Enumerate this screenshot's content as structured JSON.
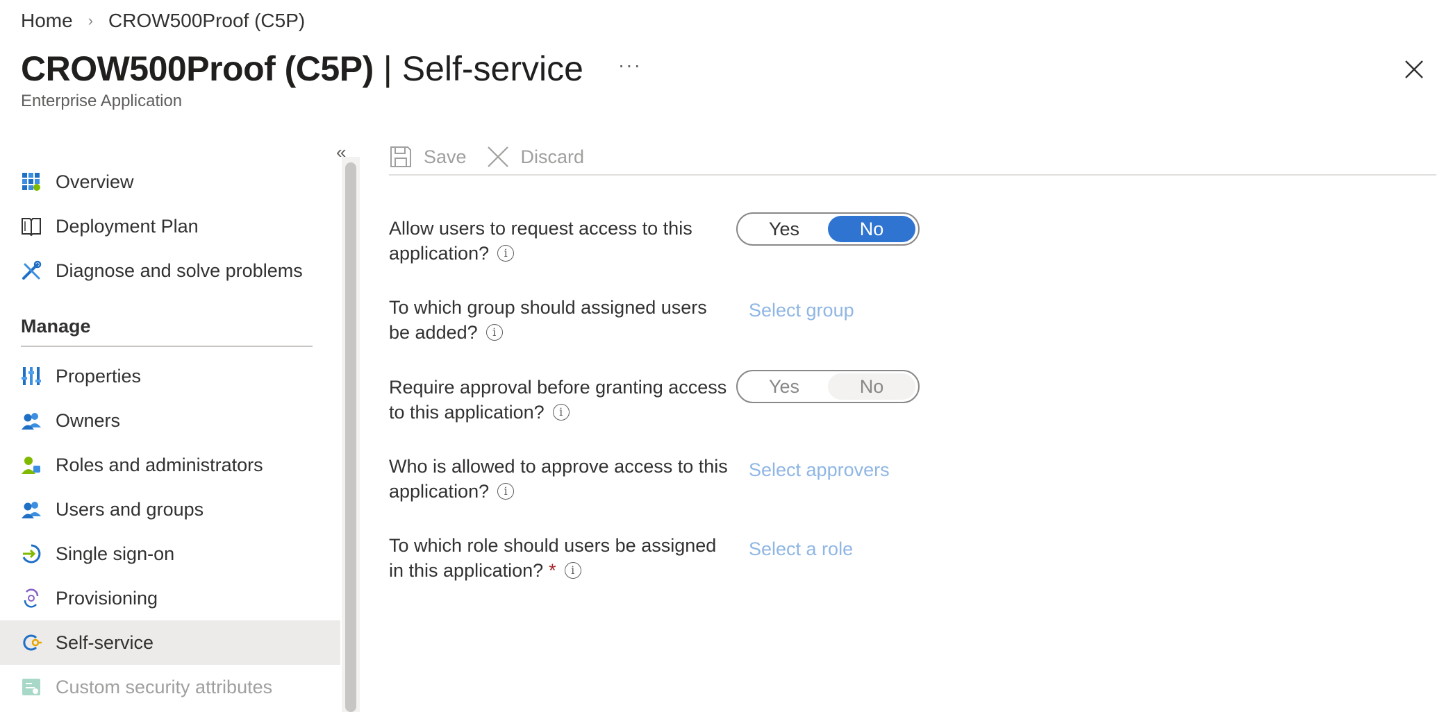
{
  "breadcrumb": {
    "home": "Home",
    "sep": "›",
    "current": "CROW500Proof (C5P)"
  },
  "header": {
    "title_main": "CROW500Proof (C5P)",
    "title_sep": "|",
    "title_sub": "Self-service",
    "more": "···",
    "subtitle": "Enterprise Application"
  },
  "sidebar": {
    "collapse": "«",
    "items_top": [
      {
        "label": "Overview",
        "icon": "grid-icon"
      },
      {
        "label": "Deployment Plan",
        "icon": "book-icon"
      },
      {
        "label": "Diagnose and solve problems",
        "icon": "wrench-icon"
      }
    ],
    "section_manage": "Manage",
    "items_manage": [
      {
        "label": "Properties",
        "icon": "properties-icon"
      },
      {
        "label": "Owners",
        "icon": "owners-icon"
      },
      {
        "label": "Roles and administrators",
        "icon": "roles-icon"
      },
      {
        "label": "Users and groups",
        "icon": "users-icon"
      },
      {
        "label": "Single sign-on",
        "icon": "sso-icon"
      },
      {
        "label": "Provisioning",
        "icon": "provisioning-icon"
      },
      {
        "label": "Self-service",
        "icon": "self-service-icon",
        "active": true
      },
      {
        "label": "Custom security attributes",
        "icon": "custom-attributes-icon",
        "disabled": true
      }
    ]
  },
  "toolbar": {
    "save_label": "Save",
    "discard_label": "Discard"
  },
  "form": {
    "allow_request": {
      "label": "Allow users to request access to this application?",
      "yes": "Yes",
      "no": "No",
      "selected": "No"
    },
    "assign_group": {
      "label": "To which group should assigned users be added?",
      "link": "Select group"
    },
    "require_approval": {
      "label": "Require approval before granting access to this application?",
      "yes": "Yes",
      "no": "No",
      "selected": "No",
      "disabled": true
    },
    "approvers": {
      "label": "Who is allowed to approve access to this application?",
      "link": "Select approvers"
    },
    "role": {
      "label": "To which role should users be assigned in this application?",
      "required_mark": "*",
      "link": "Select a role"
    },
    "info_glyph": "i"
  },
  "colors": {
    "accent": "#2f74d0",
    "link": "#8fb6e4",
    "required": "#a4262c",
    "active_bg": "#edebe9"
  }
}
